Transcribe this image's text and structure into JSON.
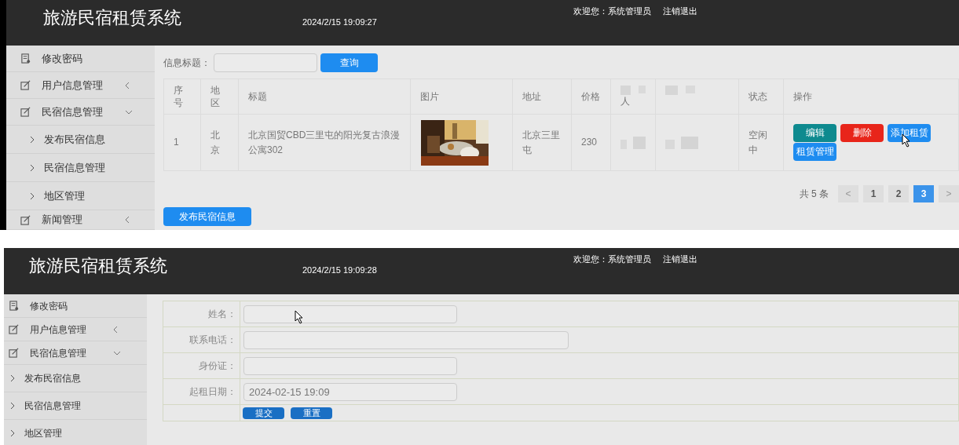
{
  "screens": [
    {
      "header": {
        "title": "旅游民宿租赁系统",
        "datetime": "2024/2/15 19:09:27",
        "welcome": "欢迎您：系统管理员",
        "logout": "注销退出"
      },
      "sidebar": [
        {
          "label": "修改密码",
          "kind": "link"
        },
        {
          "label": "用户信息管理",
          "kind": "group",
          "expanded": false
        },
        {
          "label": "民宿信息管理",
          "kind": "group",
          "expanded": true
        },
        {
          "label": "发布民宿信息",
          "kind": "sub"
        },
        {
          "label": "民宿信息管理",
          "kind": "sub"
        },
        {
          "label": "地区管理",
          "kind": "sub"
        },
        {
          "label": "新闻管理",
          "kind": "group",
          "expanded": false
        }
      ],
      "search": {
        "label": "信息标题：",
        "button": "查询"
      },
      "table": {
        "columns": [
          {
            "label": "序号",
            "kind": "text"
          },
          {
            "label": "地区",
            "kind": "text"
          },
          {
            "label": "标题",
            "kind": "text"
          },
          {
            "label": "图片",
            "kind": "text"
          },
          {
            "label": "地址",
            "kind": "text"
          },
          {
            "label": "价格",
            "kind": "text"
          },
          {
            "label": "人",
            "kind": "blurred"
          },
          {
            "kind": "blurred"
          },
          {
            "label": "状态",
            "kind": "text"
          },
          {
            "label": "操作",
            "kind": "text"
          }
        ],
        "rows": [
          {
            "cells": [
              {
                "kind": "text",
                "text": "1"
              },
              {
                "kind": "text",
                "text": "北京"
              },
              {
                "kind": "text",
                "text": "北京国贸CBD三里屯的阳光复古浪漫公寓302"
              },
              {
                "kind": "picture"
              },
              {
                "kind": "text",
                "text": "北京三里屯"
              },
              {
                "kind": "text",
                "text": "230"
              },
              {
                "kind": "blurred"
              },
              {
                "kind": "blurred"
              },
              {
                "kind": "text",
                "text": "空闲中"
              },
              {
                "kind": "actions",
                "buttons": [
                  {
                    "label": "编辑",
                    "color": "#0e8a8f"
                  },
                  {
                    "label": "删除",
                    "color": "#e8251a"
                  },
                  {
                    "label": "添加租赁",
                    "color": "#1e8cf0"
                  },
                  {
                    "label": "租赁管理",
                    "color": "#1e8cf0"
                  }
                ]
              }
            ]
          }
        ]
      },
      "pagination": {
        "total": "共 5 条",
        "prev": "<",
        "pages": [
          {
            "label": "1",
            "selected": false
          },
          {
            "label": "2",
            "selected": false
          },
          {
            "label": "3",
            "selected": true
          }
        ],
        "next": ">"
      },
      "add_button": "发布民宿信息"
    },
    {
      "header": {
        "title": "旅游民宿租赁系统",
        "datetime": "2024/2/15 19:09:28",
        "welcome": "欢迎您：系统管理员",
        "logout": "注销退出"
      },
      "sidebar": [
        {
          "label": "修改密码",
          "kind": "link"
        },
        {
          "label": "用户信息管理",
          "kind": "group",
          "expanded": false
        },
        {
          "label": "民宿信息管理",
          "kind": "group",
          "expanded": true
        },
        {
          "label": "发布民宿信息",
          "kind": "sub"
        },
        {
          "label": "民宿信息管理",
          "kind": "sub"
        },
        {
          "label": "地区管理",
          "kind": "sub"
        }
      ],
      "form": {
        "fields": [
          {
            "label": "姓名：",
            "kind": "short"
          },
          {
            "label": "联系电话：",
            "kind": "long"
          },
          {
            "label": "身份证：",
            "kind": "short"
          },
          {
            "label": "起租日期：",
            "kind": "short",
            "value": "2024-02-15 19:09"
          }
        ],
        "buttons": [
          "提交",
          "重置"
        ]
      }
    }
  ]
}
